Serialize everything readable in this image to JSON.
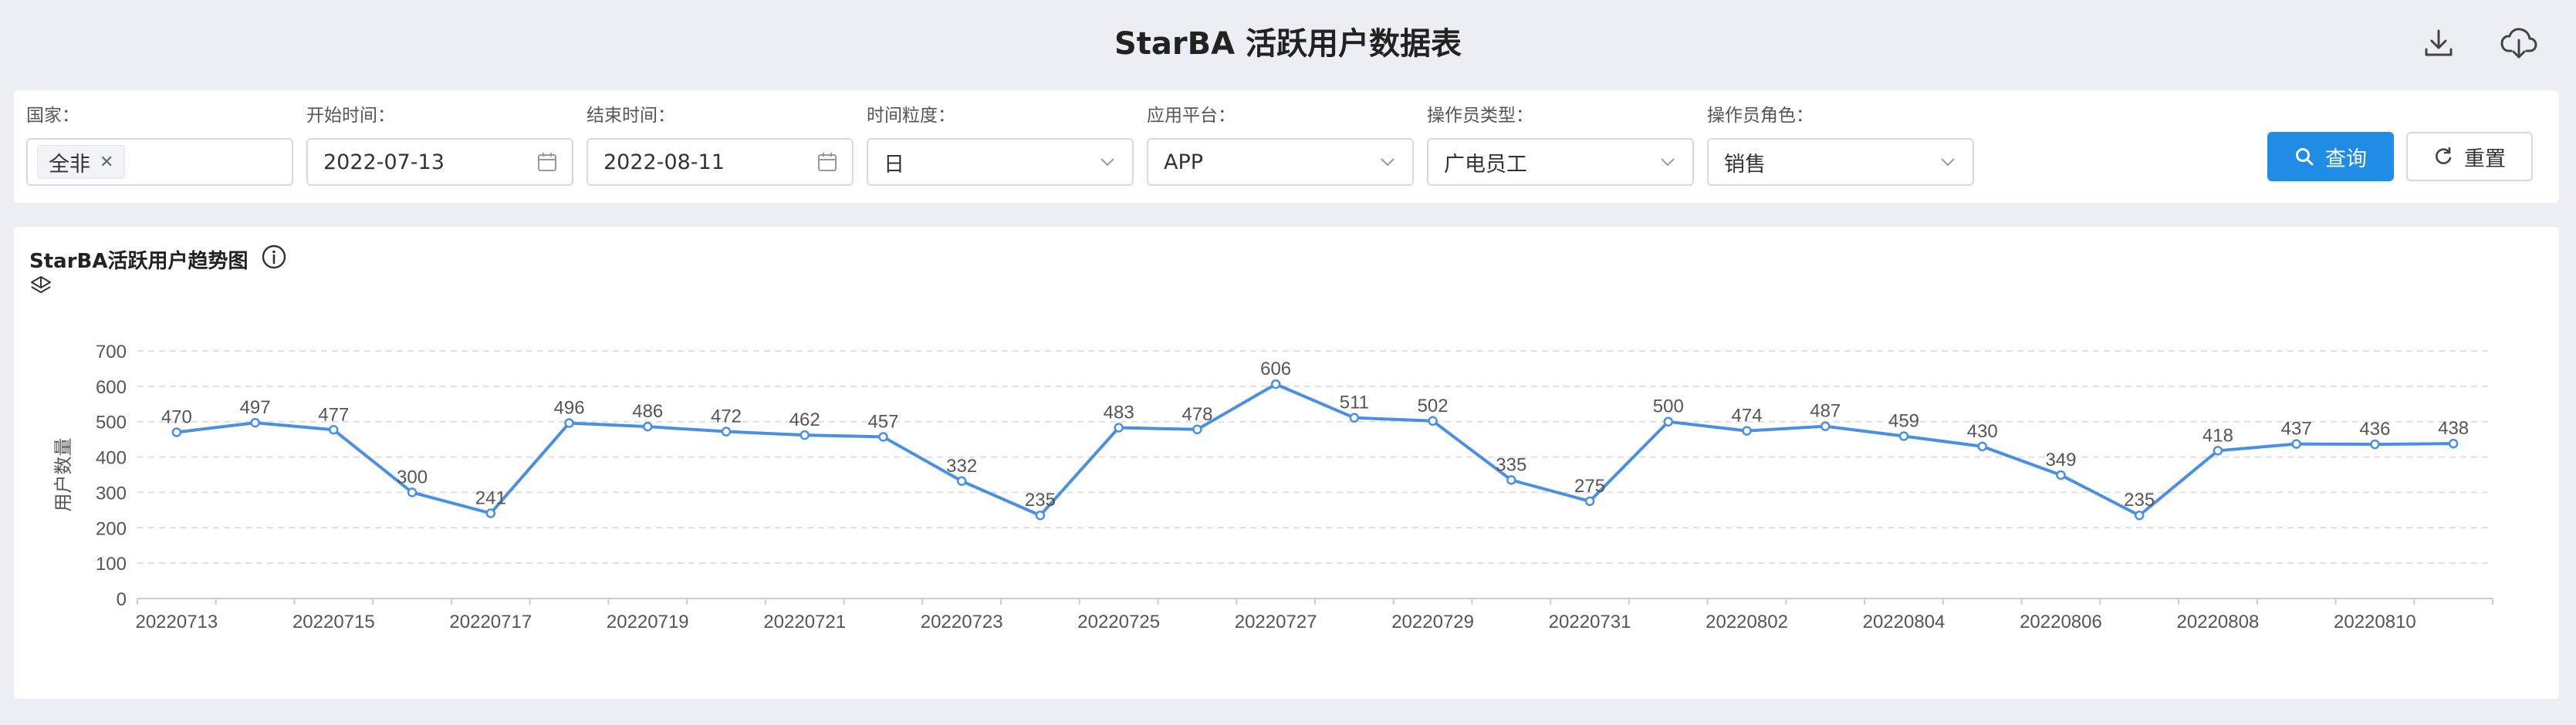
{
  "header": {
    "title": "StarBA 活跃用户数据表",
    "download_icon": "download-icon",
    "cloud_download_icon": "cloud-download-icon"
  },
  "filters": {
    "country": {
      "label": "国家：",
      "tag": "全非"
    },
    "start_date": {
      "label": "开始时间：",
      "value": "2022-07-13"
    },
    "end_date": {
      "label": "结束时间：",
      "value": "2022-08-11"
    },
    "granularity": {
      "label": "时间粒度：",
      "value": "日"
    },
    "platform": {
      "label": "应用平台：",
      "value": "APP"
    },
    "operator_type": {
      "label": "操作员类型：",
      "value": "广电员工"
    },
    "operator_role": {
      "label": "操作员角色：",
      "value": "销售"
    }
  },
  "actions": {
    "query_label": "查询",
    "reset_label": "重置"
  },
  "chart_panel": {
    "title": "StarBA活跃用户趋势图"
  },
  "colors": {
    "accent": "#1f8ce6",
    "line": "#4a90e2",
    "background": "#eceef3"
  },
  "chart_data": {
    "type": "line",
    "title": "StarBA活跃用户趋势图",
    "ylabel": "用户数量",
    "xlabel": "",
    "ylim": [
      0,
      700
    ],
    "yticks": [
      0,
      100,
      200,
      300,
      400,
      500,
      600,
      700
    ],
    "grid": true,
    "x": [
      "20220713",
      "20220714",
      "20220715",
      "20220716",
      "20220717",
      "20220718",
      "20220719",
      "20220720",
      "20220721",
      "20220722",
      "20220723",
      "20220724",
      "20220725",
      "20220726",
      "20220727",
      "20220728",
      "20220729",
      "20220730",
      "20220731",
      "20220801",
      "20220802",
      "20220803",
      "20220804",
      "20220805",
      "20220806",
      "20220807",
      "20220808",
      "20220809",
      "20220810",
      "20220811"
    ],
    "xtick_labels": [
      "20220713",
      "20220715",
      "20220717",
      "20220719",
      "20220721",
      "20220723",
      "20220725",
      "20220727",
      "20220729",
      "20220731",
      "20220802",
      "20220804",
      "20220806",
      "20220808",
      "20220810"
    ],
    "values": [
      470,
      497,
      477,
      300,
      241,
      496,
      486,
      472,
      462,
      457,
      332,
      235,
      483,
      478,
      606,
      511,
      502,
      335,
      275,
      500,
      474,
      487,
      459,
      430,
      349,
      235,
      418,
      437,
      436,
      438
    ]
  }
}
